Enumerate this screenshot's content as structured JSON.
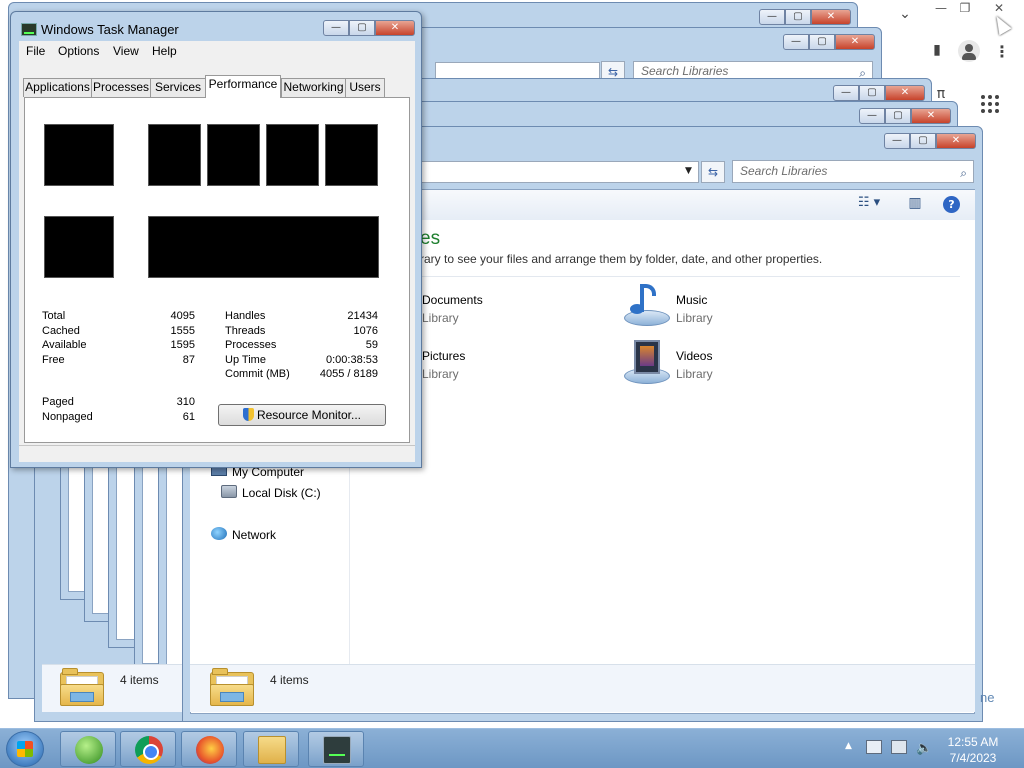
{
  "chrome": {
    "minimize": "—",
    "restore": "❐",
    "close": "✕",
    "chevron": "⌄",
    "sidebar_icon": "▮",
    "menu_icon": "⋮",
    "extra_icon": "π"
  },
  "explorer_back": {
    "search_placeholder": "Search Libraries"
  },
  "explorer": {
    "search_placeholder": "Search Libraries",
    "heading": "es",
    "description": "rary to see your files and arrange them by folder, date, and other properties.",
    "libraries": [
      {
        "name": "Documents",
        "type": "Library"
      },
      {
        "name": "Music",
        "type": "Library"
      },
      {
        "name": "Pictures",
        "type": "Library"
      },
      {
        "name": "Videos",
        "type": "Library"
      }
    ],
    "nav": {
      "computer": "My Computer",
      "disk": "Local Disk (C:)",
      "network": "Network"
    },
    "status": "4 items",
    "status_back": "4 items",
    "status_partial": "ne"
  },
  "task_manager": {
    "title": "Windows Task Manager",
    "menu": [
      "File",
      "Options",
      "View",
      "Help"
    ],
    "tabs": [
      "Applications",
      "Processes",
      "Services",
      "Performance",
      "Networking",
      "Users"
    ],
    "active_tab": "Performance",
    "memory": {
      "total_label": "Total",
      "total": "4095",
      "cached_label": "Cached",
      "cached": "1555",
      "available_label": "Available",
      "available": "1595",
      "free_label": "Free",
      "free": "87"
    },
    "system": {
      "handles_label": "Handles",
      "handles": "21434",
      "threads_label": "Threads",
      "threads": "1076",
      "processes_label": "Processes",
      "processes": "59",
      "uptime_label": "Up Time",
      "uptime": "0:00:38:53",
      "commit_label": "Commit (MB)",
      "commit": "4055 / 8189"
    },
    "kernel": {
      "paged_label": "Paged",
      "paged": "310",
      "nonpaged_label": "Nonpaged",
      "nonpaged": "61"
    },
    "resource_button": "Resource Monitor..."
  },
  "taskbar": {
    "pinned": [
      "windows-media-player",
      "google-chrome",
      "firefox",
      "windows-explorer",
      "task-manager"
    ],
    "clock_time": "12:55 AM",
    "clock_date": "7/4/2023",
    "tray_arrow": "▲"
  },
  "colors": {
    "window_frame": "#bcd3ea",
    "library_heading": "#1e7f2e",
    "taskbar": "#6d97c4",
    "graph_bg": "#000000"
  }
}
